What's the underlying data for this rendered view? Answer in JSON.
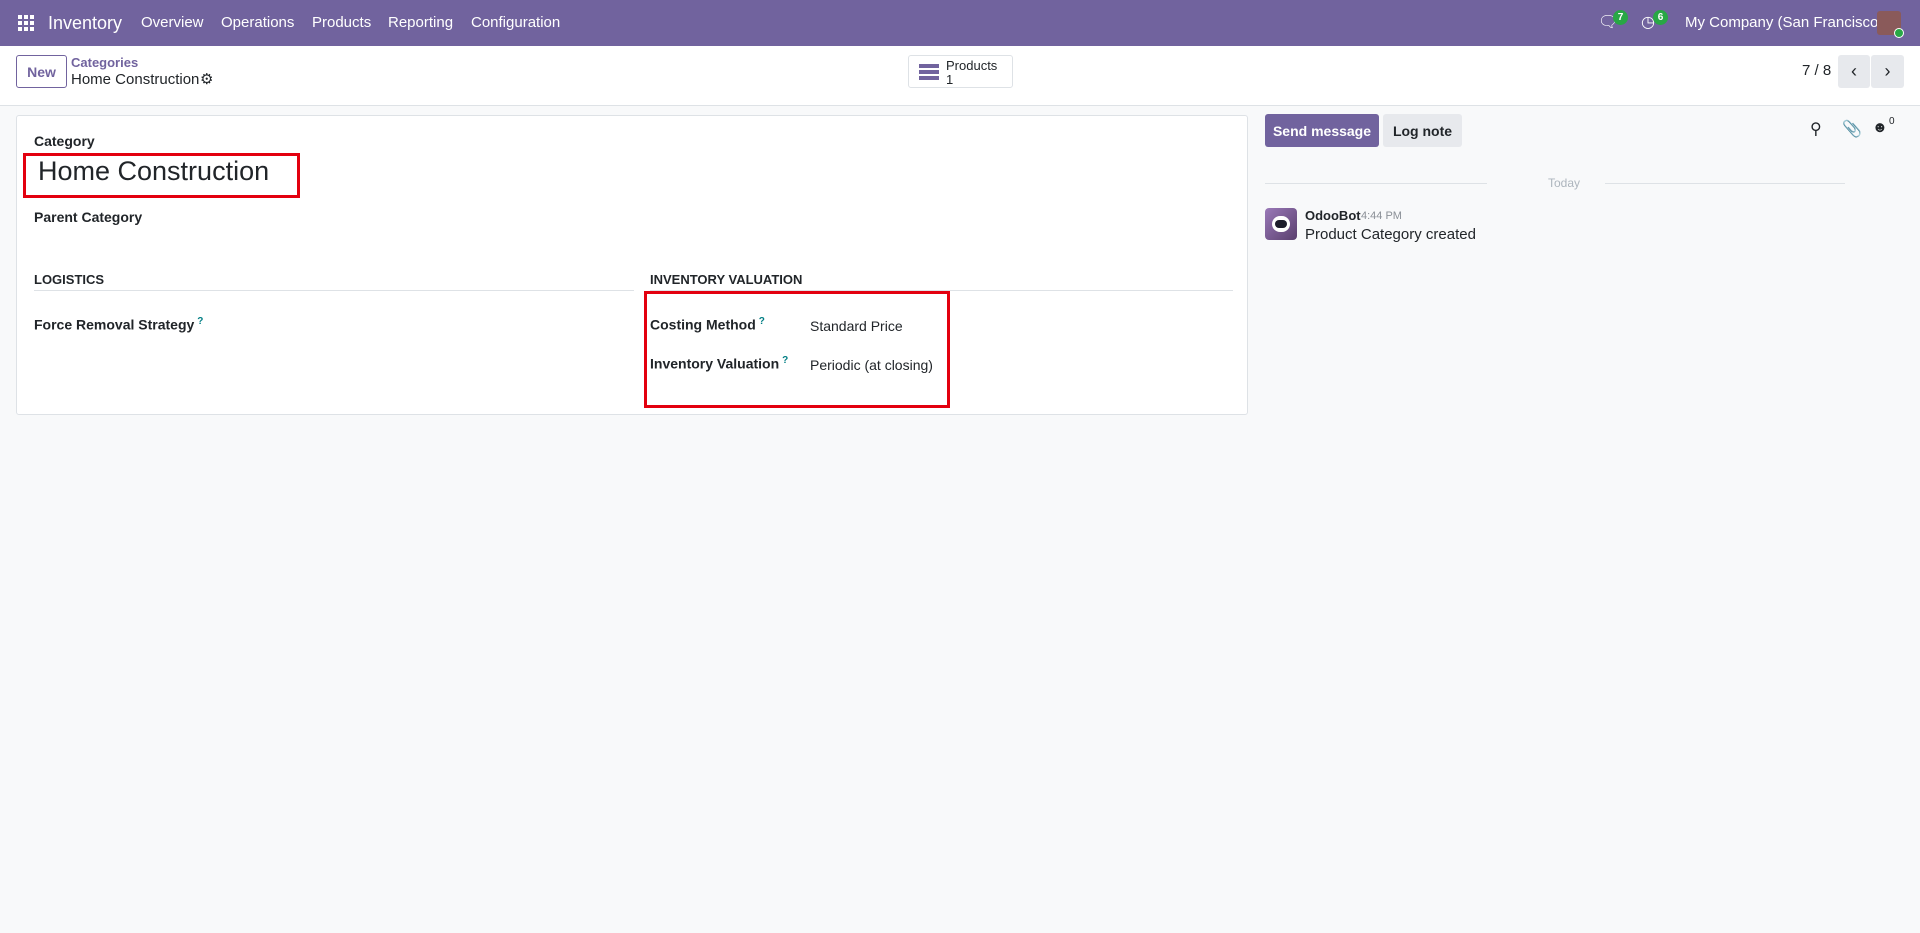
{
  "nav": {
    "app": "Inventory",
    "menu": [
      "Overview",
      "Operations",
      "Products",
      "Reporting",
      "Configuration"
    ],
    "messages_count": "7",
    "activities_count": "6",
    "company": "My Company (San Francisco)"
  },
  "control": {
    "new_label": "New",
    "breadcrumb_parent": "Categories",
    "breadcrumb_current": "Home Construction",
    "smart_button_label": "Products",
    "smart_button_count": "1",
    "pager": "7 / 8"
  },
  "form": {
    "category_label": "Category",
    "category_name": "Home Construction",
    "parent_label": "Parent Category",
    "logistics_title": "LOGISTICS",
    "removal_label": "Force Removal Strategy",
    "valuation_title": "INVENTORY VALUATION",
    "costing_label": "Costing Method",
    "costing_value": "Standard Price",
    "valuation_label": "Inventory Valuation",
    "valuation_value": "Periodic (at closing)",
    "help_mark": "?"
  },
  "chatter": {
    "send_message": "Send message",
    "log_note": "Log note",
    "followers_count": "0",
    "date_separator": "Today",
    "messages": [
      {
        "author": "OdooBot",
        "time": "4:44 PM",
        "body": "Product Category created"
      }
    ]
  },
  "colors": {
    "brand": "#71639e",
    "highlight": "#e3000f",
    "badge": "#28a745"
  }
}
